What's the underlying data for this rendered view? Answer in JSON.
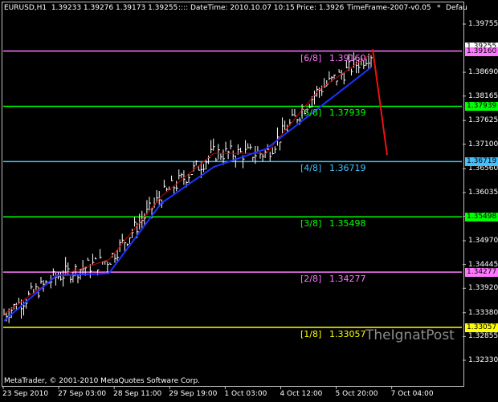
{
  "header": {
    "symbol_info": "EURUSD,H1  1.39233 1.39276 1.39173 1.39255",
    "datetime": ":::: DateTime: 2010.10.07 10:15",
    "price": "Price: 1.3926",
    "timeframe": "TimeFrame-2007-v0.05",
    "star": "*",
    "default_text": "Defau"
  },
  "footer": "MetaTrader, © 2001-2010 MetaQuotes Software Corp.",
  "watermark": "TheIgnatPost",
  "price_axis": {
    "ticks": [
      "1.39755",
      "1.38690",
      "1.38165",
      "1.37625",
      "1.37100",
      "1.36560",
      "1.36035",
      "1.35510",
      "1.34970",
      "1.34445",
      "1.33920",
      "1.33380",
      "1.32855",
      "1.32330"
    ]
  },
  "time_axis": {
    "ticks": [
      "23 Sep 2010",
      "27 Sep 03:00",
      "28 Sep 11:00",
      "29 Sep 19:00",
      "1 Oct 03:00",
      "4 Oct 12:00",
      "5 Oct 20:00",
      "7 Oct 04:00"
    ]
  },
  "price_boxes": [
    {
      "value": "1.39255",
      "color": "#ffffff"
    },
    {
      "value": "1.39160",
      "color": "#ff77ff"
    },
    {
      "value": "1.37939",
      "color": "#00ff00"
    },
    {
      "value": "1.36719",
      "color": "#40c0ff"
    },
    {
      "value": "1.35498",
      "color": "#00ff00"
    },
    {
      "value": "1.34277",
      "color": "#ff77ff"
    },
    {
      "value": "1.33057",
      "color": "#ffff00"
    }
  ],
  "murrey_levels": [
    {
      "name": "[6/8]",
      "value": "1.39160",
      "color": "#ff77ff"
    },
    {
      "name": "[5/8]",
      "value": "1.37939",
      "color": "#00ff00"
    },
    {
      "name": "[4/8]",
      "value": "1.36719",
      "color": "#40c0ff"
    },
    {
      "name": "[3/8]",
      "value": "1.35498",
      "color": "#00ff00"
    },
    {
      "name": "[2/8]",
      "value": "1.34277",
      "color": "#ff77ff"
    },
    {
      "name": "[1/8]",
      "value": "1.33057",
      "color": "#ffff00"
    }
  ],
  "colors": {
    "background": "#000000",
    "bars": "#ffffff",
    "ma_fast": "#cc0000",
    "ma_slow": "#1a33ff",
    "projection": "#ee1111"
  },
  "chart_data": {
    "type": "line",
    "title": "EURUSD,H1",
    "ylim": [
      1.3233,
      1.39755
    ],
    "x": [
      "23 Sep 2010",
      "27 Sep 03:00",
      "28 Sep 11:00",
      "29 Sep 19:00",
      "1 Oct 03:00",
      "4 Oct 12:00",
      "5 Oct 20:00",
      "7 Oct 04:00"
    ],
    "series": [
      {
        "values": [
          1.3335,
          1.3418,
          1.3455,
          1.3595,
          1.369,
          1.369,
          1.383,
          1.391
        ]
      },
      {
        "values": [
          1.332,
          1.342,
          1.3425,
          1.358,
          1.366,
          1.37,
          1.379,
          1.388
        ]
      }
    ],
    "projection": [
      [
        1.392,
        1.3686
      ]
    ]
  }
}
